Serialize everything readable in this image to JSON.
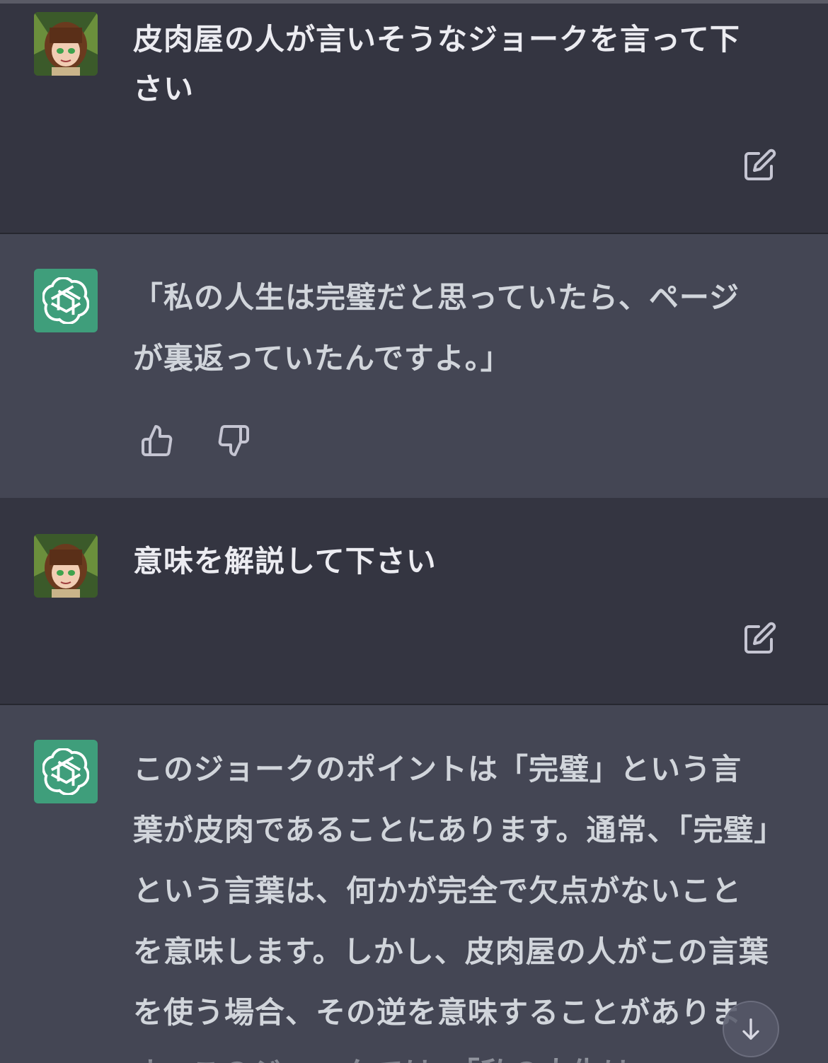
{
  "conversation": [
    {
      "role": "user",
      "avatar_icon": "user-anime-avatar-icon",
      "text": "皮肉屋の人が言いそうなジョークを言って下さい",
      "edit_icon": "edit-icon"
    },
    {
      "role": "assistant",
      "avatar_icon": "openai-logo-icon",
      "text": "「私の人生は完璧だと思っていたら、ページが裏返っていたんですよ。」",
      "feedback_icons": [
        "thumbs-up-icon",
        "thumbs-down-icon"
      ]
    },
    {
      "role": "user",
      "avatar_icon": "user-anime-avatar-icon",
      "text": "意味を解説して下さい",
      "edit_icon": "edit-icon"
    },
    {
      "role": "assistant",
      "avatar_icon": "openai-logo-icon",
      "text": "このジョークのポイントは「完璧」という言葉が皮肉であることにあります。通常、「完璧」という言葉は、何かが完全で欠点がないことを意味します。しかし、皮肉屋の人がこの言葉を使う場合、その逆を意味することがあります。このジョークでは、「私の人生は"
    }
  ],
  "colors": {
    "user_bg": "#343541",
    "assistant_bg": "#444654",
    "assistant_avatar_bg": "#3f9e7b",
    "text": "#ececf1"
  },
  "scroll_button_icon": "arrow-down-icon"
}
